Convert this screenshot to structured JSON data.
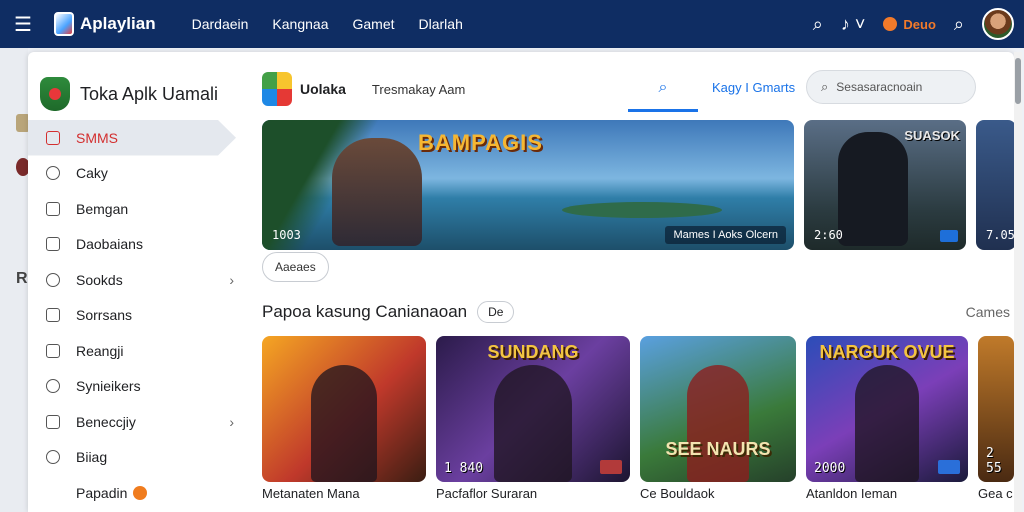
{
  "topbar": {
    "brand": "Aplaylian",
    "nav": [
      "Dardaein",
      "Kangnaa",
      "Gamet",
      "Dlarlah"
    ],
    "deal_label": "Deuo"
  },
  "sidebar": {
    "title": "Toka Aplk Uamali",
    "items": [
      {
        "label": "SMMS",
        "active": true
      },
      {
        "label": "Caky"
      },
      {
        "label": "Bemgan"
      },
      {
        "label": "Daobaians"
      },
      {
        "label": "Sookds",
        "has_chevron": true
      },
      {
        "label": "Sorrsans"
      },
      {
        "label": "Reangji"
      },
      {
        "label": "Synieikers"
      },
      {
        "label": "Beneccjiy",
        "has_chevron": true
      },
      {
        "label": "Biiag"
      },
      {
        "label": "Papadin",
        "badge": true
      }
    ]
  },
  "tabs": {
    "app_name": "Uolaka",
    "sub_label": "Tresmakay  Aam",
    "link": "Kagy I Gmarts",
    "search_placeholder": "Sesasaracnoain"
  },
  "hero": {
    "main_title": "BAMPAGIS",
    "main_number": "1003",
    "main_caption": "Mames  I Aoks  Olcern",
    "side_title": "SUASOK",
    "side_number": "2:60",
    "peek_number": "7.05"
  },
  "chip_label": "Aaeaes",
  "section": {
    "title": "Papoa kasung Canianaoan",
    "pill": "De",
    "link": "Cames"
  },
  "games": [
    {
      "number": "",
      "banner": "",
      "caption": "Metanaten Mana"
    },
    {
      "number": "1 840",
      "banner": "SUNDANG",
      "caption": "Pacfaflor Suraran"
    },
    {
      "number": "",
      "banner2": "SEE NAURS",
      "caption": "Ce Bouldaok"
    },
    {
      "number": "2000",
      "banner": "NARGUK OVUE",
      "caption": "Atanldon Ieman"
    },
    {
      "number": "2 55",
      "banner": "",
      "caption": "Gea c"
    }
  ],
  "colors": {
    "topbar": "#0f2d63",
    "accent": "#1a73e8",
    "active_nav": "#d32f2f",
    "deal": "#f27a2a"
  }
}
